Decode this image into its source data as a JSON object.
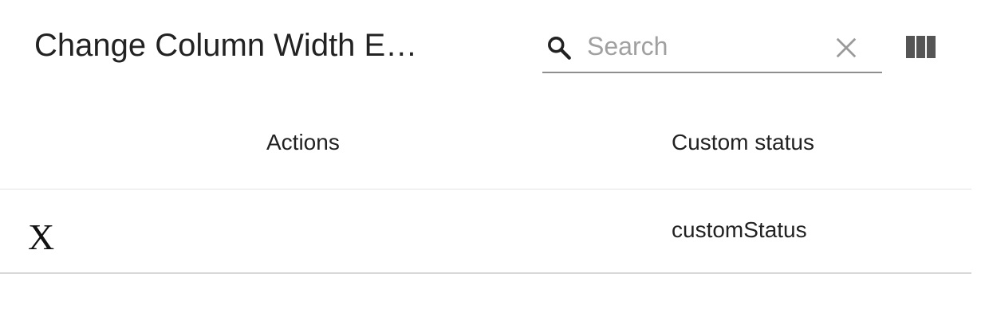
{
  "toolbar": {
    "title": "Change Column Width E…",
    "search": {
      "placeholder": "Search",
      "value": "",
      "icon": "search-icon",
      "clear_icon": "close-icon"
    },
    "columns_icon": "view-column-icon"
  },
  "table": {
    "columns": [
      "Actions",
      "Custom status"
    ],
    "rows": [
      {
        "action_label": "X",
        "custom_status": "customStatus"
      }
    ]
  },
  "colors": {
    "text": "#222222",
    "placeholder": "#a0a0a0",
    "divider": "#e2e2e2",
    "icon": "#555555"
  }
}
